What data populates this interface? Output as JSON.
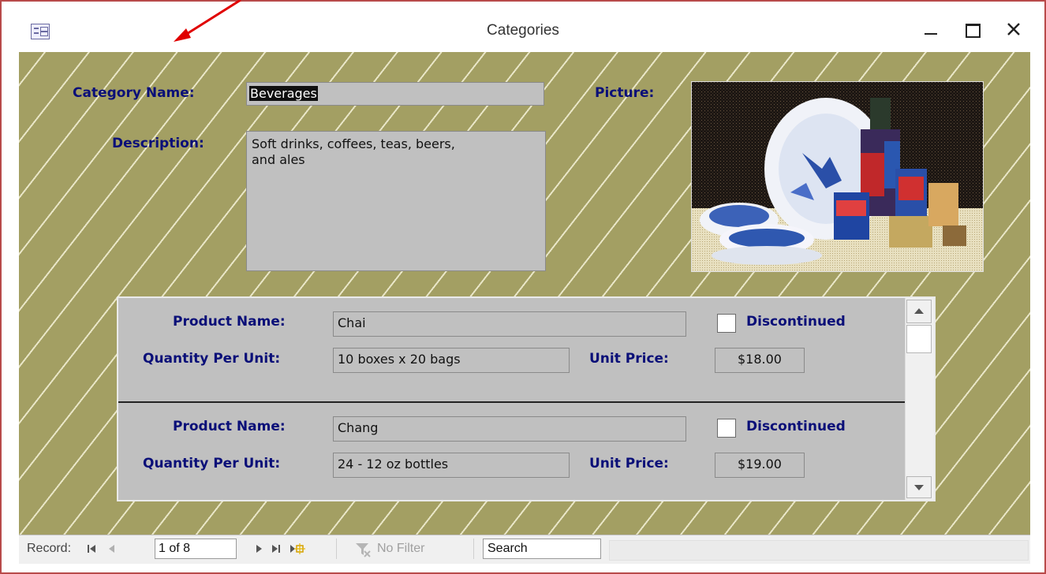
{
  "window": {
    "title": "Categories"
  },
  "form": {
    "category_name_label": "Category Name:",
    "category_name_value": "Beverages",
    "description_label": "Description:",
    "description_value": "Soft drinks, coffees, teas, beers,\nand ales",
    "picture_label": "Picture:"
  },
  "subform": {
    "records": [
      {
        "product_name_label": "Product Name:",
        "product_name": "Chai",
        "discontinued_label": "Discontinued",
        "discontinued": false,
        "quantity_label": "Quantity Per Unit:",
        "quantity": "10 boxes x 20 bags",
        "unit_price_label": "Unit Price:",
        "unit_price": "$18.00"
      },
      {
        "product_name_label": "Product Name:",
        "product_name": "Chang",
        "discontinued_label": "Discontinued",
        "discontinued": false,
        "quantity_label": "Quantity Per Unit:",
        "quantity": "24 - 12 oz bottles",
        "unit_price_label": "Unit Price:",
        "unit_price": "$19.00"
      }
    ]
  },
  "nav": {
    "record_label": "Record:",
    "counter": "1 of 8",
    "filter_label": "No Filter",
    "search_value": "Search"
  },
  "colors": {
    "label_blue": "#0a0f78",
    "form_bg": "#a39f63",
    "annotation_arrow": "#e00000"
  }
}
